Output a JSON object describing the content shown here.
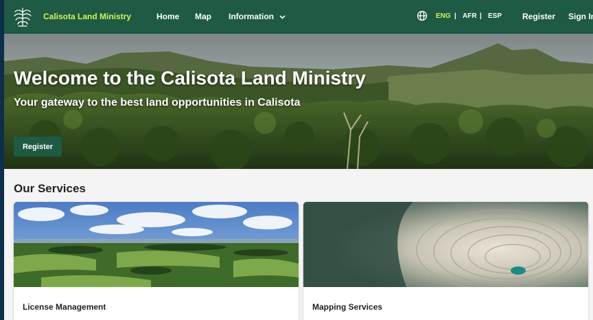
{
  "nav": {
    "brand": "Calisota Land Ministry",
    "links": [
      "Home",
      "Map",
      "Information"
    ],
    "languages": [
      "ENG",
      "AFR",
      "ESP"
    ],
    "active_language": "ENG",
    "register": "Register",
    "sign_in": "Sign In"
  },
  "hero": {
    "title": "Welcome to the Calisota Land Ministry",
    "subtitle": "Your gateway to the best land opportunities in Calisota",
    "cta": "Register"
  },
  "services": {
    "heading": "Our Services",
    "cards": [
      {
        "title": "License Management"
      },
      {
        "title": "Mapping Services"
      }
    ]
  },
  "colors": {
    "primary": "#1e5a44",
    "accent": "#d4f25a",
    "page_bg": "#f4f4f4"
  }
}
